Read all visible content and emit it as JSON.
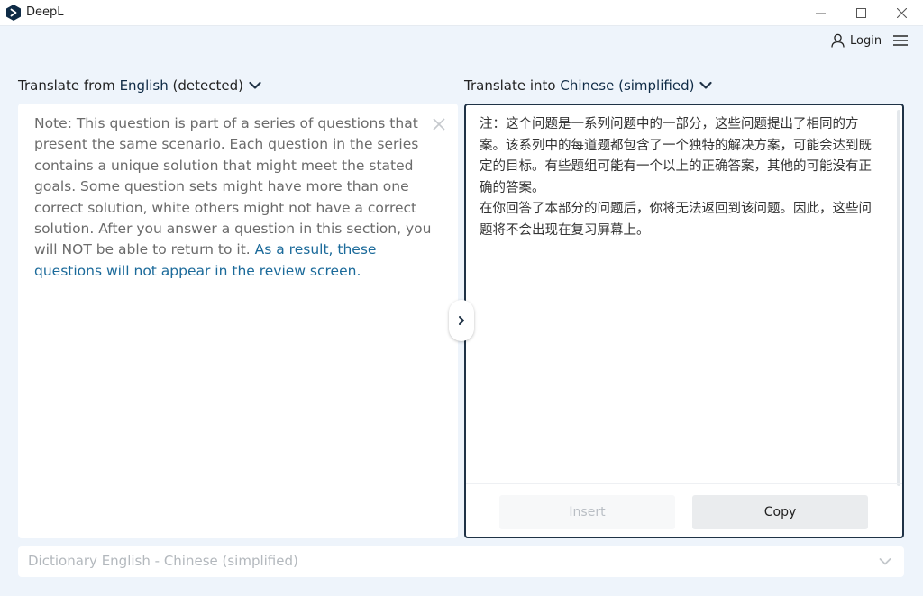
{
  "app": {
    "title": "DeepL"
  },
  "header": {
    "login_label": "Login"
  },
  "source": {
    "label_prefix": "Translate from ",
    "language": "English",
    "detected_suffix": " (detected)",
    "text_plain": "Note: This question is part of a series of questions that present the same scenario. Each question in the series contains a unique solution that might meet the stated goals. Some question sets might have more than one correct solution, white others might not have a correct solution. After you answer a question in this section, you will NOT be able to return to it. ",
    "text_highlight": "As a result, these questions will not appear in the review screen."
  },
  "target": {
    "label_prefix": "Translate into ",
    "language": "Chinese (simplified)",
    "paragraph1": "注：这个问题是一系列问题中的一部分，这些问题提出了相同的方案。该系列中的每道题都包含了一个独特的解决方案，可能会达到既定的目标。有些题组可能有一个以上的正确答案，其他的可能没有正确的答案。",
    "paragraph2": "在你回答了本部分的问题后，你将无法返回到该问题。因此，这些问题将不会出现在复习屏幕上。",
    "insert_label": "Insert",
    "copy_label": "Copy"
  },
  "dictionary": {
    "label": "Dictionary English - Chinese (simplified)"
  },
  "icons": {
    "logo": "deepl-logo-icon",
    "user": "user-icon",
    "menu": "hamburger-menu-icon",
    "clear": "close-icon",
    "chevron": "chevron-down-icon",
    "expand": "chevron-right-icon"
  },
  "colors": {
    "brand_dark": "#0f2b46",
    "highlight_text": "#1b6a9a",
    "target_border": "#1f3246",
    "background": "#eef4fb"
  }
}
